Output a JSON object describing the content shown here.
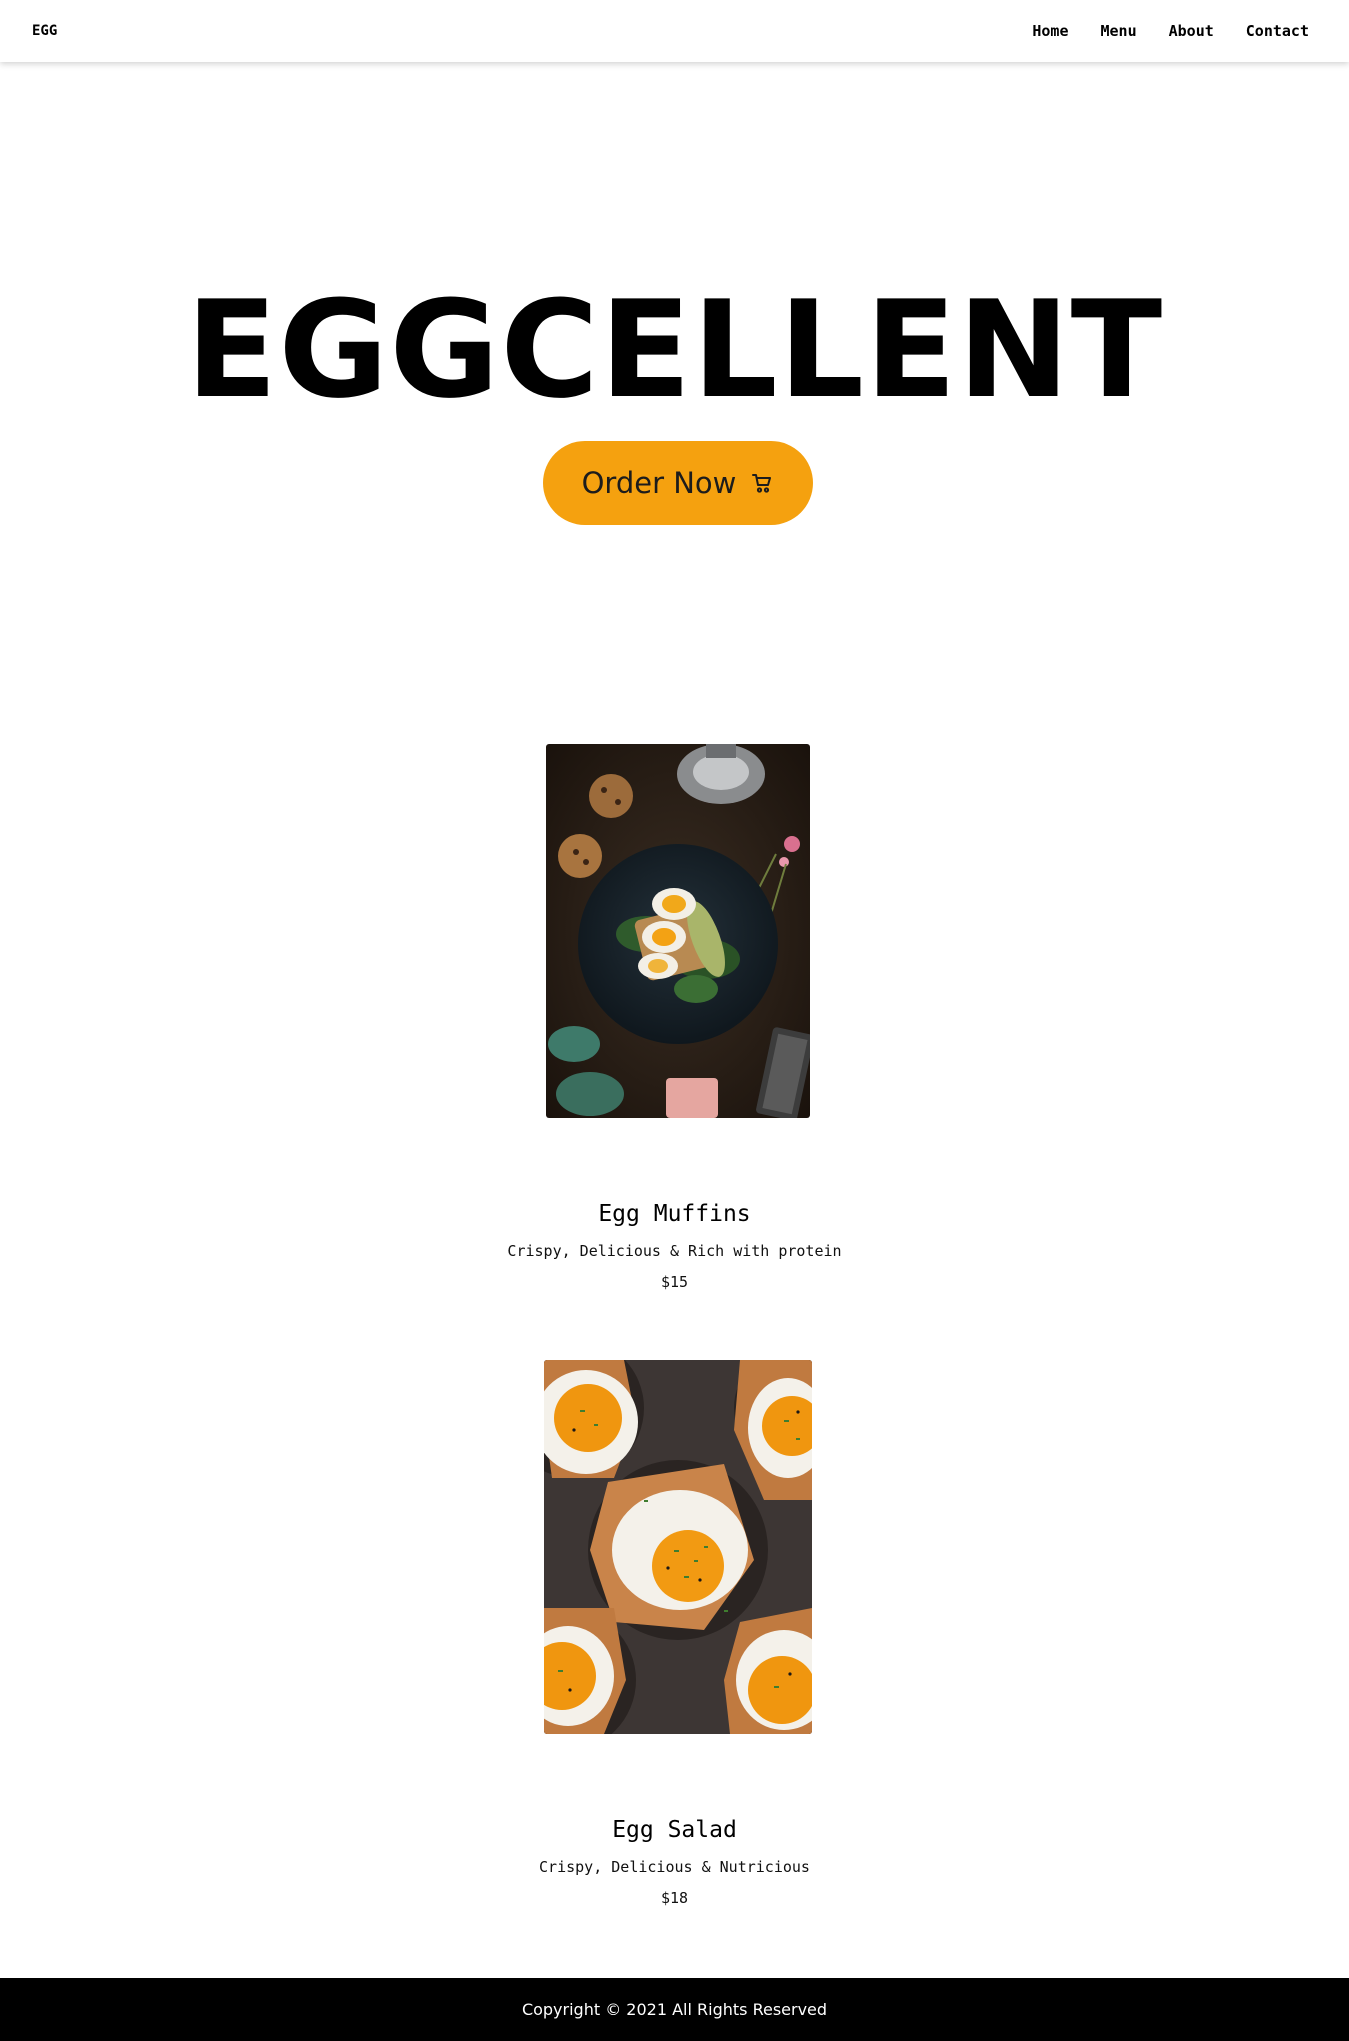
{
  "nav": {
    "brand": "EGG",
    "links": [
      "Home",
      "Menu",
      "About",
      "Contact"
    ]
  },
  "hero": {
    "title": "EGGCELLENT",
    "cta_label": "Order Now",
    "cta_icon": "cart-icon",
    "cta_color": "#f5a10f"
  },
  "menu": {
    "items": [
      {
        "name": "Egg Muffins",
        "description": "Crispy, Delicious & Rich with protein",
        "price": "$15",
        "image": "boiled-egg-toast-photo"
      },
      {
        "name": "Egg Salad",
        "description": "Crispy, Delicious & Nutricious",
        "price": "$18",
        "image": "egg-toast-cups-photo"
      }
    ]
  },
  "footer": {
    "copyright": "Copyright © 2021 All Rights Reserved"
  }
}
